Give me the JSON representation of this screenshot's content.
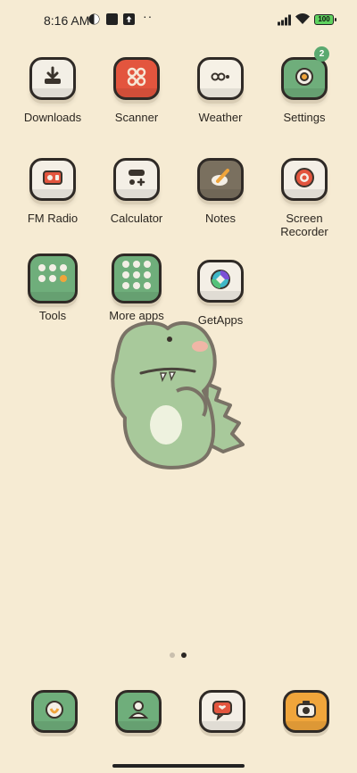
{
  "status_bar": {
    "time": "8:16 AM",
    "more": "··",
    "battery": "100"
  },
  "apps": [
    {
      "id": "downloads",
      "label": "Downloads",
      "icon": "download-icon",
      "color": "#f3efe6"
    },
    {
      "id": "scanner",
      "label": "Scanner",
      "icon": "scanner-icon",
      "color": "#e3553e"
    },
    {
      "id": "weather",
      "label": "Weather",
      "icon": "weather-icon",
      "color": "#f6f1e6"
    },
    {
      "id": "settings",
      "label": "Settings",
      "icon": "gear-icon",
      "color": "#6fae7b",
      "badge": "2"
    },
    {
      "id": "fm-radio",
      "label": "FM Radio",
      "icon": "radio-icon",
      "color": "#f4efe6"
    },
    {
      "id": "calculator",
      "label": "Calculator",
      "icon": "calculator-icon",
      "color": "#f4efe6"
    },
    {
      "id": "notes",
      "label": "Notes",
      "icon": "notes-icon",
      "color": "#7a705f"
    },
    {
      "id": "screen-recorder",
      "label": "Screen\nRecorder",
      "label_line1": "Screen",
      "label_line2": "Recorder",
      "icon": "record-icon",
      "color": "#f4efe6"
    },
    {
      "id": "tools",
      "label": "Tools",
      "icon": "folder-icon",
      "color": "#6fae7b"
    },
    {
      "id": "more-apps",
      "label": "More apps",
      "icon": "folder-icon",
      "color": "#6fae7b"
    },
    {
      "id": "getapps",
      "label": "GetApps",
      "icon": "getapps-icon",
      "color": "#f4efe6"
    }
  ],
  "dock": [
    {
      "id": "phone",
      "icon": "phone-icon",
      "color": "#6fae7b"
    },
    {
      "id": "contacts",
      "icon": "contacts-icon",
      "color": "#6fae7b"
    },
    {
      "id": "messages",
      "icon": "messages-icon",
      "color": "#f4efe6"
    },
    {
      "id": "camera",
      "icon": "camera-icon",
      "color": "#f0a53b"
    }
  ],
  "page_indicator": {
    "pages": 2,
    "active": 2
  }
}
